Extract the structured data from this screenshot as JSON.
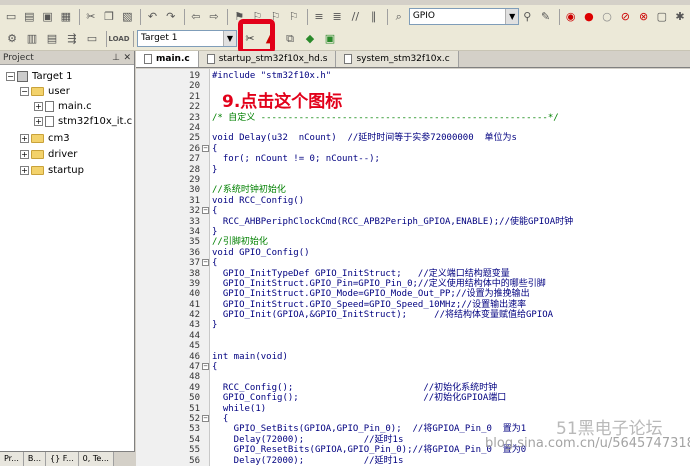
{
  "toolbar1": {
    "target_combo": "GPIO"
  },
  "toolbar2": {
    "target_select": "Target 1"
  },
  "annotation_text": "9.点击这个图标",
  "project_panel": {
    "title": "Project",
    "tree": [
      {
        "label": "Target 1",
        "kind": "target",
        "exp": "−"
      },
      {
        "label": "user",
        "kind": "folder",
        "exp": "−"
      },
      {
        "label": "main.c",
        "kind": "file",
        "exp": "+"
      },
      {
        "label": "stm32f10x_it.c",
        "kind": "file",
        "exp": "+"
      },
      {
        "label": "cm3",
        "kind": "folder",
        "exp": "+"
      },
      {
        "label": "driver",
        "kind": "folder",
        "exp": "+"
      },
      {
        "label": "startup",
        "kind": "folder",
        "exp": "+"
      }
    ],
    "bottom_tabs": [
      "Pr...",
      "B...",
      "{} F...",
      "0, Te..."
    ]
  },
  "editor_tabs": [
    {
      "label": "main.c",
      "active": true
    },
    {
      "label": "startup_stm32f10x_hd.s",
      "active": false
    },
    {
      "label": "system_stm32f10x.c",
      "active": false
    }
  ],
  "code_lines": [
    {
      "n": "19",
      "fold": "",
      "text": "#include \"stm32f10x.h\"",
      "cm": false
    },
    {
      "n": "20",
      "fold": "",
      "text": "",
      "cm": false
    },
    {
      "n": "21",
      "fold": "",
      "text": "",
      "cm": false
    },
    {
      "n": "22",
      "fold": "",
      "text": "",
      "cm": false
    },
    {
      "n": "23",
      "fold": "",
      "text": "/* 自定义 -----------------------------------------------------*/",
      "cm": true
    },
    {
      "n": "24",
      "fold": "",
      "text": "",
      "cm": false
    },
    {
      "n": "25",
      "fold": "",
      "text": "void Delay(u32  nCount)  //延时时间等于实参72000000  单位为s",
      "cm": false
    },
    {
      "n": "26",
      "fold": "−",
      "text": "{",
      "cm": false
    },
    {
      "n": "27",
      "fold": "",
      "text": "  for(; nCount != 0; nCount--);",
      "cm": false
    },
    {
      "n": "28",
      "fold": "",
      "text": "}",
      "cm": false
    },
    {
      "n": "29",
      "fold": "",
      "text": "",
      "cm": false
    },
    {
      "n": "30",
      "fold": "",
      "text": "//系统时钟初始化",
      "cm": true
    },
    {
      "n": "31",
      "fold": "",
      "text": "void RCC_Config()",
      "cm": false
    },
    {
      "n": "32",
      "fold": "−",
      "text": "{",
      "cm": false
    },
    {
      "n": "33",
      "fold": "",
      "text": "  RCC_AHBPeriphClockCmd(RCC_APB2Periph_GPIOA,ENABLE);//使能GPIOA时钟",
      "cm": false
    },
    {
      "n": "34",
      "fold": "",
      "text": "}",
      "cm": false
    },
    {
      "n": "35",
      "fold": "",
      "text": "//引脚初始化",
      "cm": true
    },
    {
      "n": "36",
      "fold": "",
      "text": "void GPIO_Config()",
      "cm": false
    },
    {
      "n": "37",
      "fold": "−",
      "text": "{",
      "cm": false
    },
    {
      "n": "38",
      "fold": "",
      "text": "  GPIO_InitTypeDef GPIO_InitStruct;   //定义端口结构题变量",
      "cm": false
    },
    {
      "n": "39",
      "fold": "",
      "text": "  GPIO_InitStruct.GPIO_Pin=GPIO_Pin_0;//定义使用结构体中的哪些引脚",
      "cm": false
    },
    {
      "n": "40",
      "fold": "",
      "text": "  GPIO_InitStruct.GPIO_Mode=GPIO_Mode_Out_PP;//设置为推挽输出",
      "cm": false
    },
    {
      "n": "41",
      "fold": "",
      "text": "  GPIO_InitStruct.GPIO_Speed=GPIO_Speed_10MHz;//设置输出速率",
      "cm": false
    },
    {
      "n": "42",
      "fold": "",
      "text": "  GPIO_Init(GPIOA,&GPIO_InitStruct);     //将结构体变量赋值给GPIOA",
      "cm": false
    },
    {
      "n": "43",
      "fold": "",
      "text": "}",
      "cm": false
    },
    {
      "n": "44",
      "fold": "",
      "text": "",
      "cm": false
    },
    {
      "n": "45",
      "fold": "",
      "text": "",
      "cm": false
    },
    {
      "n": "46",
      "fold": "",
      "text": "int main(void)",
      "cm": false
    },
    {
      "n": "47",
      "fold": "−",
      "text": "{",
      "cm": false
    },
    {
      "n": "48",
      "fold": "",
      "text": "",
      "cm": false
    },
    {
      "n": "49",
      "fold": "",
      "text": "  RCC_Config();                        //初始化系统时钟",
      "cm": false
    },
    {
      "n": "50",
      "fold": "",
      "text": "  GPIO_Config();                       //初始化GPIOA端口",
      "cm": false
    },
    {
      "n": "51",
      "fold": "",
      "text": "  while(1)",
      "cm": false
    },
    {
      "n": "52",
      "fold": "−",
      "text": "  {",
      "cm": false
    },
    {
      "n": "53",
      "fold": "",
      "text": "    GPIO_SetBits(GPIOA,GPIO_Pin_0);  //将GPIOA_Pin_0  置为1",
      "cm": false
    },
    {
      "n": "54",
      "fold": "",
      "text": "    Delay(72000);           //延时1s",
      "cm": false
    },
    {
      "n": "55",
      "fold": "",
      "text": "    GPIO_ResetBits(GPIOA,GPIO_Pin_0);//将GPIOA_Pin_0  置为0",
      "cm": false
    },
    {
      "n": "56",
      "fold": "",
      "text": "    Delay(72000);           //延时1s",
      "cm": false
    }
  ],
  "watermark": "blog.sina.com.cn/u/5645747318",
  "watermark_cn": "51黑电子论坛",
  "colors": {
    "highlight": "#e2001a",
    "keyword": "#000080",
    "comment": "#008000"
  }
}
